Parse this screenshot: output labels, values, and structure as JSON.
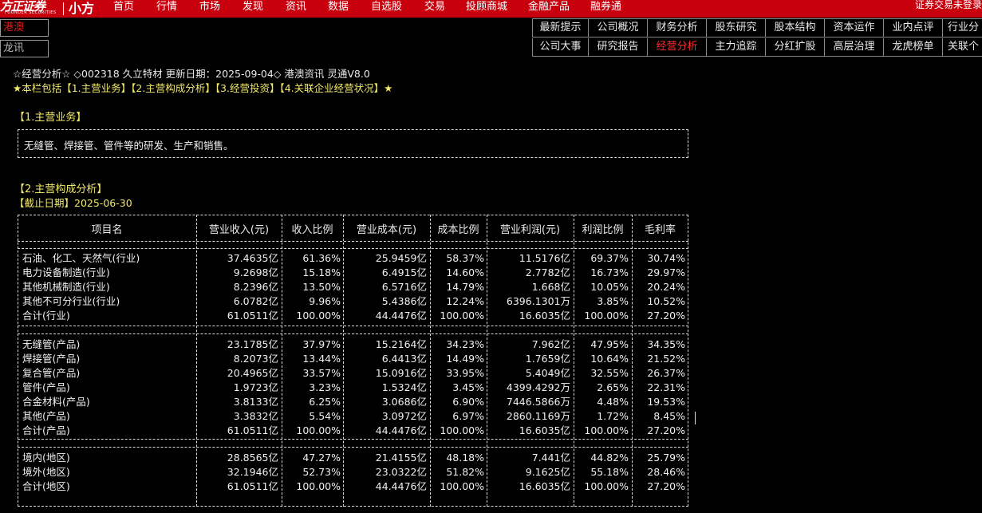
{
  "topbar": {
    "logo_text": "方正证券",
    "logo_sub": "FOUNDER SECURITIES",
    "logo_product": "小方",
    "nav": [
      "首页",
      "行情",
      "市场",
      "发现",
      "资讯",
      "数据",
      "自选股",
      "交易",
      "投顾商城",
      "金融产品",
      "融券通"
    ],
    "login_status": "证券交易未登录"
  },
  "side": {
    "hk_label": "港澳",
    "lx_label": "龙讯"
  },
  "tabs": {
    "row1": [
      "最新提示",
      "公司概况",
      "财务分析",
      "股东研究",
      "股本结构",
      "资本运作",
      "业内点评",
      "行业分"
    ],
    "row2": [
      "公司大事",
      "研究报告",
      "经营分析",
      "主力追踪",
      "分红扩股",
      "高层治理",
      "龙虎榜单",
      "关联个"
    ],
    "active": "经营分析"
  },
  "header": {
    "line1": "☆经营分析☆ ◇002318 久立特材 更新日期：2025-09-04◇ 港澳资讯 灵通V8.0",
    "line2": "★本栏包括【1.主营业务】【2.主营构成分析】【3.经营投资】【4.关联企业经营状况】★"
  },
  "section1": {
    "title": "【1.主营业务】",
    "text": "无缝管、焊接管、管件等的研发、生产和销售。"
  },
  "section2": {
    "title": "【2.主营构成分析】",
    "date": "【截止日期】2025-06-30",
    "columns": [
      "项目名",
      "营业收入(元)",
      "收入比例",
      "营业成本(元)",
      "成本比例",
      "营业利润(元)",
      "利润比例",
      "毛利率"
    ],
    "groups": [
      {
        "rows": [
          [
            "石油、化工、天然气(行业)",
            "37.4635亿",
            "61.36%",
            "25.9459亿",
            "58.37%",
            "11.5176亿",
            "69.37%",
            "30.74%"
          ],
          [
            "电力设备制造(行业)",
            "9.2698亿",
            "15.18%",
            "6.4915亿",
            "14.60%",
            "2.7782亿",
            "16.73%",
            "29.97%"
          ],
          [
            "其他机械制造(行业)",
            "8.2396亿",
            "13.50%",
            "6.5716亿",
            "14.79%",
            "1.668亿",
            "10.05%",
            "20.24%"
          ],
          [
            "其他不可分行业(行业)",
            "6.0782亿",
            "9.96%",
            "5.4386亿",
            "12.24%",
            "6396.1301万",
            "3.85%",
            "10.52%"
          ],
          [
            "合计(行业)",
            "61.0511亿",
            "100.00%",
            "44.4476亿",
            "100.00%",
            "16.6035亿",
            "100.00%",
            "27.20%"
          ]
        ]
      },
      {
        "rows": [
          [
            "无缝管(产品)",
            "23.1785亿",
            "37.97%",
            "15.2164亿",
            "34.23%",
            "7.962亿",
            "47.95%",
            "34.35%"
          ],
          [
            "焊接管(产品)",
            "8.2073亿",
            "13.44%",
            "6.4413亿",
            "14.49%",
            "1.7659亿",
            "10.64%",
            "21.52%"
          ],
          [
            "复合管(产品)",
            "20.4965亿",
            "33.57%",
            "15.0916亿",
            "33.95%",
            "5.4049亿",
            "32.55%",
            "26.37%"
          ],
          [
            "管件(产品)",
            "1.9723亿",
            "3.23%",
            "1.5324亿",
            "3.45%",
            "4399.4292万",
            "2.65%",
            "22.31%"
          ],
          [
            "合金材料(产品)",
            "3.8133亿",
            "6.25%",
            "3.0686亿",
            "6.90%",
            "7446.5866万",
            "4.48%",
            "19.53%"
          ],
          [
            "其他(产品)",
            "3.3832亿",
            "5.54%",
            "3.0972亿",
            "6.97%",
            "2860.1169万",
            "1.72%",
            "8.45%"
          ],
          [
            "合计(产品)",
            "61.0511亿",
            "100.00%",
            "44.4476亿",
            "100.00%",
            "16.6035亿",
            "100.00%",
            "27.20%"
          ]
        ]
      },
      {
        "rows": [
          [
            "境内(地区)",
            "28.8565亿",
            "47.27%",
            "21.4155亿",
            "48.18%",
            "7.441亿",
            "44.82%",
            "25.79%"
          ],
          [
            "境外(地区)",
            "32.1946亿",
            "52.73%",
            "23.0322亿",
            "51.82%",
            "9.1625亿",
            "55.18%",
            "28.46%"
          ],
          [
            "合计(地区)",
            "61.0511亿",
            "100.00%",
            "44.4476亿",
            "100.00%",
            "16.6035亿",
            "100.00%",
            "27.20%"
          ]
        ]
      }
    ]
  }
}
